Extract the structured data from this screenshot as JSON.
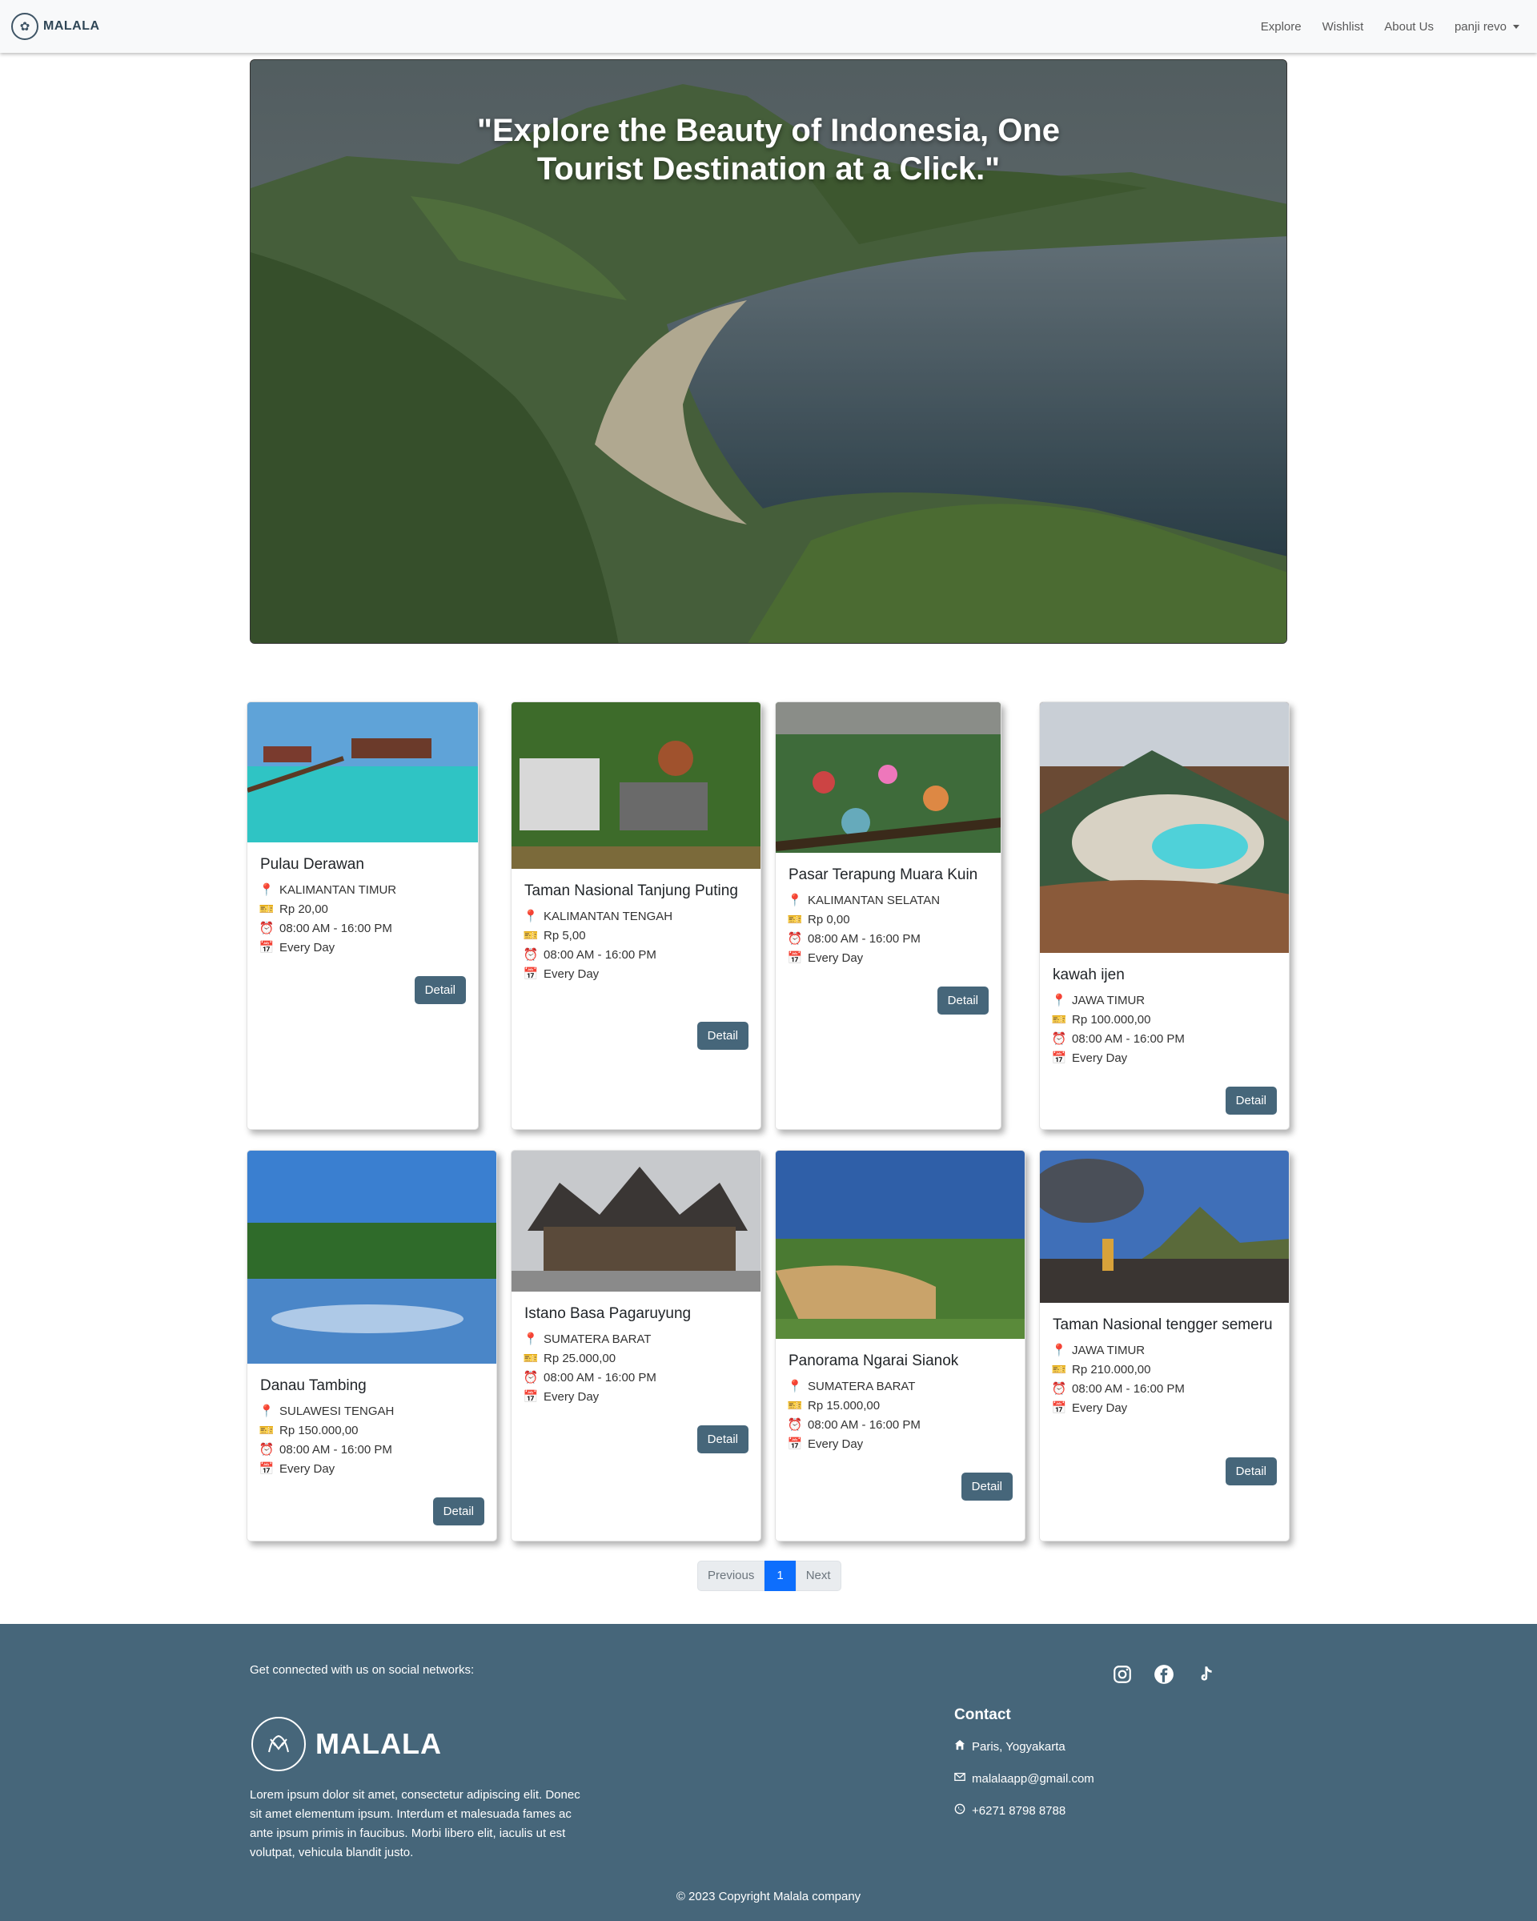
{
  "nav": {
    "brand": "MALALA",
    "links": [
      "Explore",
      "Wishlist",
      "About Us"
    ],
    "user": "panji revo"
  },
  "hero": {
    "title": "\"Explore the Beauty of Indonesia, One Tourist Destination at a Click.\""
  },
  "destinations": [
    {
      "name": "Pulau Derawan",
      "location": "KALIMANTAN TIMUR",
      "price": "Rp 20,00",
      "hours": "08:00 AM - 16:00 PM",
      "days": "Every Day",
      "button": "Detail"
    },
    {
      "name": "Taman Nasional Tanjung Puting",
      "location": "KALIMANTAN TENGAH",
      "price": "Rp 5,00",
      "hours": "08:00 AM - 16:00 PM",
      "days": "Every Day",
      "button": "Detail"
    },
    {
      "name": "Pasar Terapung Muara Kuin",
      "location": "KALIMANTAN SELATAN",
      "price": "Rp 0,00",
      "hours": "08:00 AM - 16:00 PM",
      "days": "Every Day",
      "button": "Detail"
    },
    {
      "name": "kawah ijen",
      "location": "JAWA TIMUR",
      "price": "Rp 100.000,00",
      "hours": "08:00 AM - 16:00 PM",
      "days": "Every Day",
      "button": "Detail"
    },
    {
      "name": "Danau Tambing",
      "location": "SULAWESI TENGAH",
      "price": "Rp 150.000,00",
      "hours": "08:00 AM - 16:00 PM",
      "days": "Every Day",
      "button": "Detail"
    },
    {
      "name": "Istano Basa Pagaruyung",
      "location": "SUMATERA BARAT",
      "price": "Rp 25.000,00",
      "hours": "08:00 AM - 16:00 PM",
      "days": "Every Day",
      "button": "Detail"
    },
    {
      "name": "Panorama Ngarai Sianok",
      "location": "SUMATERA BARAT",
      "price": "Rp 15.000,00",
      "hours": "08:00 AM - 16:00 PM",
      "days": "Every Day",
      "button": "Detail"
    },
    {
      "name": "Taman Nasional tengger semeru",
      "location": "JAWA TIMUR",
      "price": "Rp 210.000,00",
      "hours": "08:00 AM - 16:00 PM",
      "days": "Every Day",
      "button": "Detail"
    }
  ],
  "pagination": {
    "previous": "Previous",
    "current": "1",
    "next": "Next"
  },
  "footer": {
    "social_text": "Get connected with us on social networks:",
    "social_icons": [
      "instagram-icon",
      "facebook-icon",
      "tiktok-icon"
    ],
    "brand": "MALALA",
    "description": "Lorem ipsum dolor sit amet, consectetur adipiscing elit. Donec sit amet elementum ipsum. Interdum et malesuada fames ac ante ipsum primis in faucibus. Morbi libero elit, iaculis ut est volutpat, vehicula blandit justo.",
    "contact_title": "Contact",
    "address": "Paris, Yogyakarta",
    "email": "malalaapp@gmail.com",
    "phone": "+6271 8798 8788",
    "copyright": "© 2023 Copyright Malala company"
  },
  "colors": {
    "accent": "#46667a",
    "active_page": "#0d6efd",
    "navbar_bg": "#f8f9fa"
  }
}
